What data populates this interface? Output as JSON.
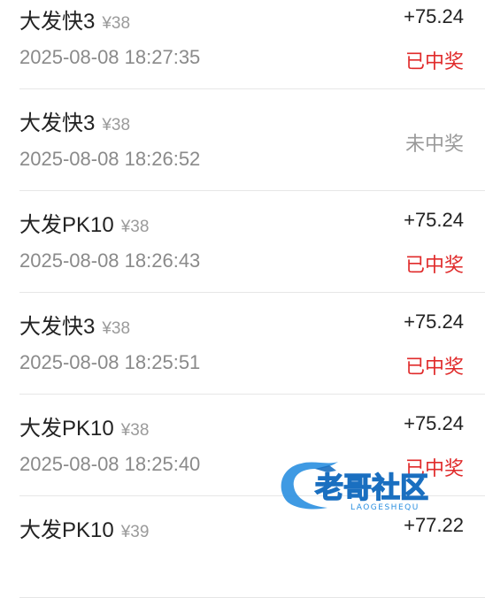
{
  "records": [
    {
      "game": "大发快3",
      "stake": "¥38",
      "time": "2025-08-08 18:27:35",
      "amount": "+75.24",
      "status": "已中奖",
      "status_color": "#e02b2b"
    },
    {
      "game": "大发快3",
      "stake": "¥38",
      "time": "2025-08-08 18:26:52",
      "amount": "",
      "status": "未中奖",
      "status_color": "#9a9a9a"
    },
    {
      "game": "大发PK10",
      "stake": "¥38",
      "time": "2025-08-08 18:26:43",
      "amount": "+75.24",
      "status": "已中奖",
      "status_color": "#e02b2b"
    },
    {
      "game": "大发快3",
      "stake": "¥38",
      "time": "2025-08-08 18:25:51",
      "amount": "+75.24",
      "status": "已中奖",
      "status_color": "#e02b2b"
    },
    {
      "game": "大发PK10",
      "stake": "¥38",
      "time": "2025-08-08 18:25:40",
      "amount": "+75.24",
      "status": "已中奖",
      "status_color": "#e02b2b"
    },
    {
      "game": "大发PK10",
      "stake": "¥39",
      "time": "",
      "amount": "+77.22",
      "status": "",
      "status_color": "#e02b2b"
    }
  ],
  "watermark": {
    "title": "老哥社区",
    "subtitle": "LAOGESHEQU"
  }
}
